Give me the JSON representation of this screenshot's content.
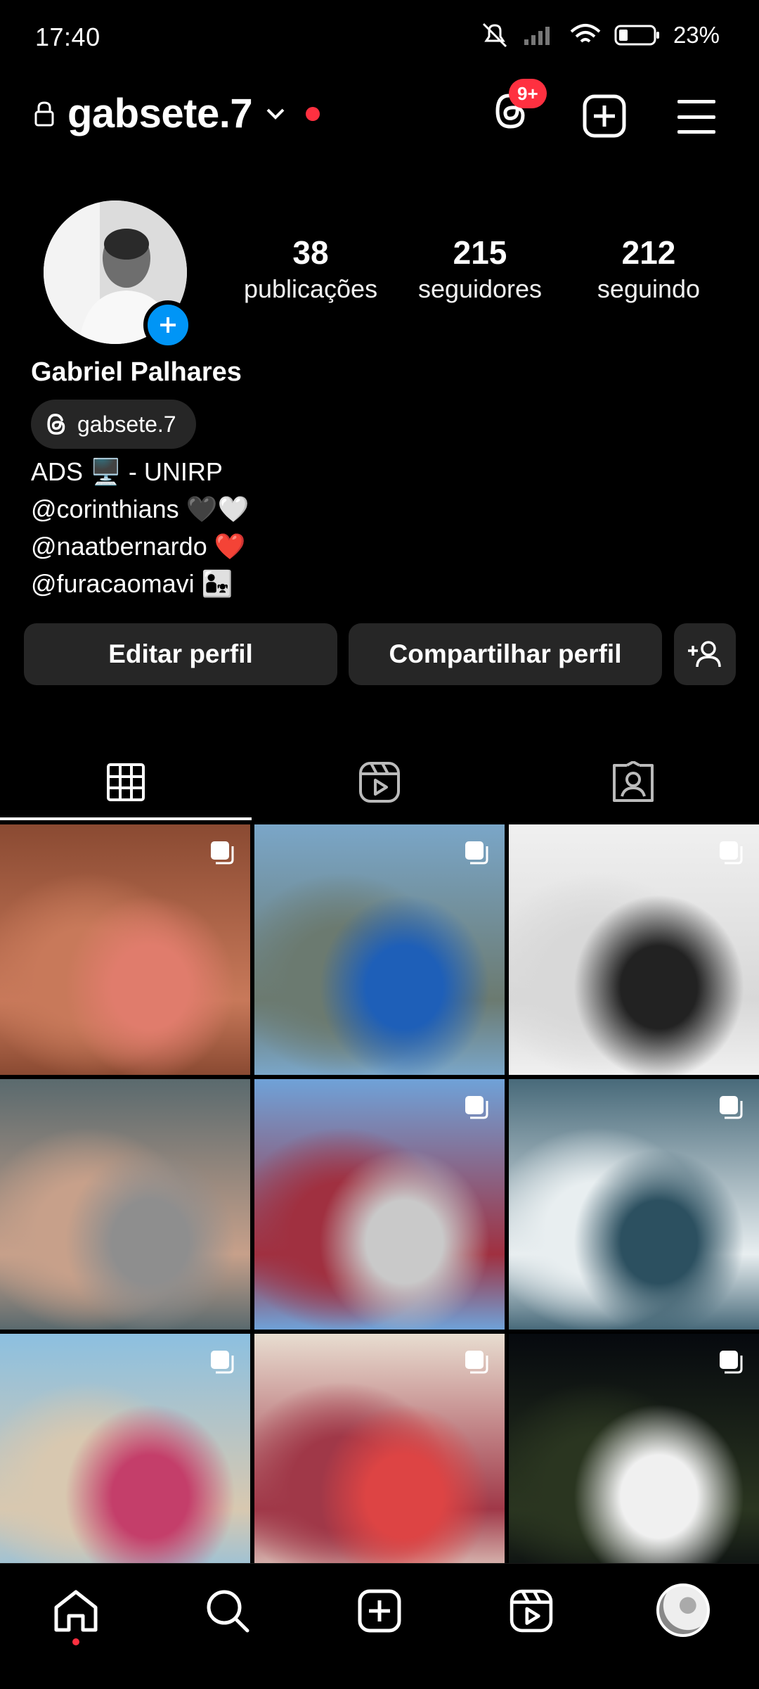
{
  "status_bar": {
    "time": "17:40",
    "battery": "23%"
  },
  "header": {
    "username": "gabsete.7",
    "threads_badge": "9+"
  },
  "profile": {
    "stats": [
      {
        "count": "38",
        "label": "publicações"
      },
      {
        "count": "215",
        "label": "seguidores"
      },
      {
        "count": "212",
        "label": "seguindo"
      }
    ],
    "full_name": "Gabriel Palhares",
    "threads_handle": "gabsete.7",
    "bio": [
      "ADS 🖥️ - UNIRP",
      "@corinthians  🖤🤍",
      "@naatbernardo  ❤️",
      "@furacaomavi 👨‍👧"
    ]
  },
  "buttons": {
    "edit": "Editar perfil",
    "share": "Compartilhar perfil"
  },
  "tabs": [
    "grid-icon",
    "reels-icon",
    "tagged-icon"
  ],
  "grid_posts": [
    {
      "multi": true,
      "colors": [
        "#8a4a32",
        "#c8795a",
        "#e07c6c"
      ]
    },
    {
      "multi": true,
      "colors": [
        "#7aa6c8",
        "#6b7a70",
        "#1e5fb8"
      ]
    },
    {
      "multi": true,
      "colors": [
        "#f0f0f0",
        "#d8d8d8",
        "#222222"
      ]
    },
    {
      "multi": false,
      "colors": [
        "#5a6a6e",
        "#c7a08a",
        "#8e8e8e"
      ]
    },
    {
      "multi": true,
      "colors": [
        "#6fa2d8",
        "#a03040",
        "#c9c9c9"
      ]
    },
    {
      "multi": true,
      "colors": [
        "#486a7a",
        "#e8eef0",
        "#2c5060"
      ]
    },
    {
      "multi": true,
      "colors": [
        "#8cc0e0",
        "#d8c8b0",
        "#c43e6a"
      ]
    },
    {
      "multi": true,
      "colors": [
        "#e8ddd0",
        "#a03848",
        "#d44"
      ]
    },
    {
      "multi": true,
      "colors": [
        "#06090e",
        "#2a3520",
        "#f0f0f0"
      ]
    }
  ],
  "bottom_nav": [
    "home-icon",
    "search-icon",
    "create-icon",
    "reels-icon",
    "profile-avatar"
  ],
  "colors": {
    "accent_blue": "#0095f6",
    "notification_red": "#ff3040",
    "button_bg": "#262626"
  }
}
